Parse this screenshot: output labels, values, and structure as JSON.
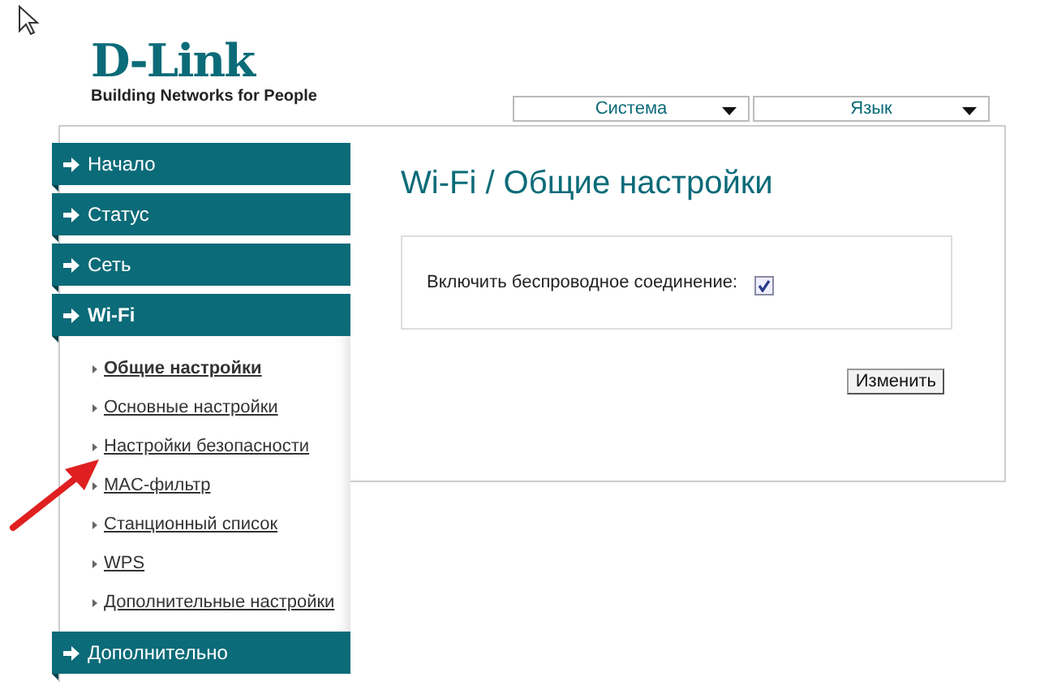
{
  "logo": {
    "brand": "D-Link",
    "tagline": "Building Networks for People"
  },
  "top_menu": [
    {
      "label": "Система"
    },
    {
      "label": "Язык"
    }
  ],
  "sidebar": {
    "sections": [
      {
        "label": "Начало",
        "expanded": false
      },
      {
        "label": "Статус",
        "expanded": false
      },
      {
        "label": "Сеть",
        "expanded": false
      },
      {
        "label": "Wi-Fi",
        "expanded": true,
        "children": [
          {
            "label": "Общие настройки",
            "selected": true
          },
          {
            "label": "Основные настройки",
            "selected": false
          },
          {
            "label": "Настройки безопасности",
            "selected": false
          },
          {
            "label": "MAC-фильтр",
            "selected": false
          },
          {
            "label": "Станционный список",
            "selected": false
          },
          {
            "label": "WPS",
            "selected": false
          },
          {
            "label": "Дополнительные настройки",
            "selected": false
          }
        ]
      },
      {
        "label": "Дополнительно",
        "expanded": false
      }
    ]
  },
  "content": {
    "title": "Wi-Fi / Общие настройки",
    "fields": [
      {
        "kind": "checkbox",
        "label": "Включить беспроводное соединение:",
        "checked": true
      }
    ],
    "button": "Изменить"
  }
}
